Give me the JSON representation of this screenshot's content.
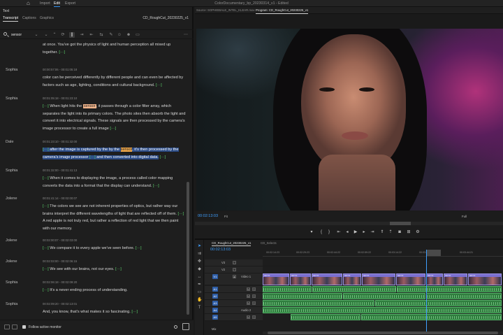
{
  "app": {
    "panel_name": "Text",
    "menu": [
      "Import",
      "Edit",
      "Export"
    ],
    "active_menu": "Edit",
    "document_title": "ColorDocumentary_bp_20230314_v1 - Edited"
  },
  "left_panel": {
    "tabs": [
      "Transcript",
      "Captions",
      "Graphics"
    ],
    "active_tab": "Transcript",
    "sequence_name": "CD_RoughCut_20230225_v1",
    "search": {
      "value": "sensor",
      "placeholder": ""
    },
    "search_dropdown_icon": "chevron-down-icon",
    "toolbar_icons": [
      "chevron-down-icon",
      "chevron-up-icon",
      "refresh-icon",
      "pause-icon",
      "insert-icon",
      "overwrite-icon",
      "extract-icon",
      "pencil-icon",
      "speaker-icon",
      "multi-speaker-icon",
      "caption-icon",
      "more-icon"
    ],
    "follow_monitor_label": "Follow active monitor",
    "follow_monitor_checked": true
  },
  "transcript": [
    {
      "speaker": "",
      "time": "",
      "text": "at once. You've got the physics of light and human perception all mixed up together.",
      "gap": "[···]"
    },
    {
      "speaker": "Sophia",
      "time": "00:00:57:06 - 00:01:05:18",
      "text": "color can be perceived differently by different people and can even be affected by factors such as age, lighting, conditions and cultural background.",
      "gap": "[···]"
    },
    {
      "speaker": "Sophia",
      "time": "00:01:05:18 - 00:01:23:10",
      "text_before": "When light hits the ",
      "highlight": "sensor",
      "text_after": ", it passes through a color filter array, which separates the light into its primary colors. The photo sites then absorb the light and convert it into electrical signals. These signals are then processed by the camera's image processor to create a full image",
      "gap": "[···]"
    },
    {
      "speaker": "Dale",
      "time": "00:01:23:10 - 00:01:32:00",
      "selected_before": "after the image is captured by the by the ",
      "highlight": "sensor",
      "selected_after": ", it's then processed by the camera's image processor",
      "selected_end": "and then converted into digital data.",
      "gap": "[···]"
    },
    {
      "speaker": "Sophia",
      "time": "00:01:32:00 - 00:01:41:13",
      "text": "When it comes to displaying the image, a process called color mapping converts the data into a format that the display can understand.",
      "gap": "[···]"
    },
    {
      "speaker": "Jolene",
      "time": "00:01:41:14 - 00:02:00:07",
      "text": "The colors we see are not inherent properties of optics, but rather way our brains interpret the different wavelengths of light that are reflected off of them.",
      "text2": "A red apple is not truly red, but rather a reflection of red light that we then paint with our memory.",
      "gap": "[···]"
    },
    {
      "speaker": "Jolene",
      "time": "00:02:00:07 - 00:02:03:00",
      "text": "We compare it to every apple we've seen before.",
      "gap": "[···]"
    },
    {
      "speaker": "Jolene",
      "time": "00:02:03:00 - 00:02:06:15",
      "text": "We see with our brains, not our eyes.",
      "gap": "[···]"
    },
    {
      "speaker": "Sophia",
      "time": "00:02:06:18 - 00:02:09:20",
      "text": "It's a never ending process of understanding.",
      "gap": "[···]"
    },
    {
      "speaker": "Sophia",
      "time": "00:02:09:20 - 00:02:13:01",
      "text": "And, you know, that's what makes it so fascinating.",
      "gap": "[···]"
    }
  ],
  "monitor": {
    "source_tab": "Source: SOPHIEBALE_INTEL_KLEAR.mov",
    "program_tab": "Program: CD_RoughCut_20230225_v1",
    "timecode": "00:02:13:03",
    "fit": "Fit",
    "resolution": "Full",
    "controls": [
      "marker-icon",
      "in-point-icon",
      "out-point-icon",
      "go-to-in-icon",
      "step-back-icon",
      "play-icon",
      "step-forward-icon",
      "go-to-out-icon",
      "lift-icon",
      "extract-icon",
      "export-frame-icon",
      "compare-icon",
      "settings-icon"
    ]
  },
  "timeline": {
    "tabs": [
      "CD_RoughCut_20230225_v1",
      "CD_Selects"
    ],
    "active_tab": "CD_RoughCut_20230225_v1",
    "timecode": "00:02:13:03",
    "ruler": [
      "00:02:14:23",
      "00:02:29:23",
      "00:02:44:22",
      "00:02:59:22",
      "00:03:14:22",
      "00:03:29:21",
      "00:03:44:21"
    ],
    "tracks": [
      {
        "label": "V3",
        "name": ""
      },
      {
        "label": "V2",
        "name": ""
      },
      {
        "label": "V1",
        "name": "Video 1"
      },
      {
        "label": "A1",
        "name": ""
      },
      {
        "label": "A2",
        "name": ""
      },
      {
        "label": "A3",
        "name": ""
      },
      {
        "label": "A4",
        "name": "Audio 2"
      },
      {
        "label": "A5",
        "name": ""
      },
      {
        "label": "A6",
        "name": ""
      }
    ],
    "mix_label": "Mix",
    "clip_label": "SKYO"
  }
}
